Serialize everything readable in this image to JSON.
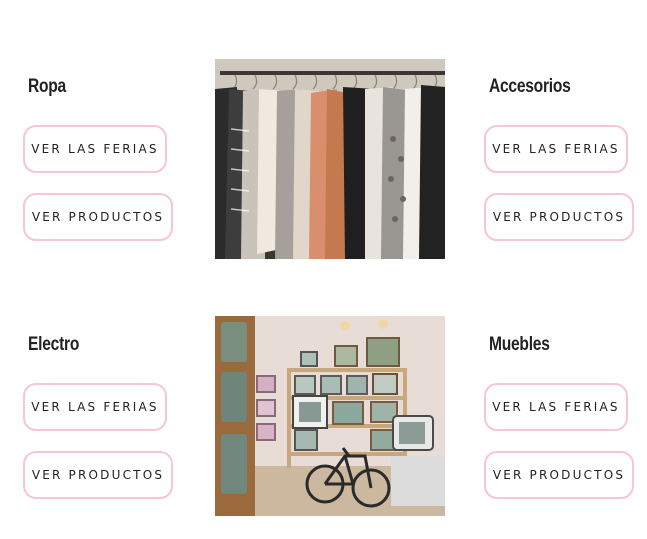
{
  "categories": [
    {
      "id": "ropa",
      "title": "Ropa",
      "ferias_label": "VER LAS FERIAS",
      "productos_label": "VER PRODUCTOS"
    },
    {
      "id": "accesorios",
      "title": "Accesorios",
      "ferias_label": "VER LAS FERIAS",
      "productos_label": "VER PRODUCTOS"
    },
    {
      "id": "electro",
      "title": "Electro",
      "ferias_label": "VER LAS FERIAS",
      "productos_label": "VER PRODUCTOS"
    },
    {
      "id": "muebles",
      "title": "Muebles",
      "ferias_label": "VER LAS FERIAS",
      "productos_label": "VER PRODUCTOS"
    }
  ],
  "images": {
    "clothing": "clothing-rack-photo",
    "electronics": "vintage-tv-store-photo"
  },
  "colors": {
    "pill_border": "#f7c5d8",
    "text": "#222222",
    "background": "#ffffff"
  }
}
